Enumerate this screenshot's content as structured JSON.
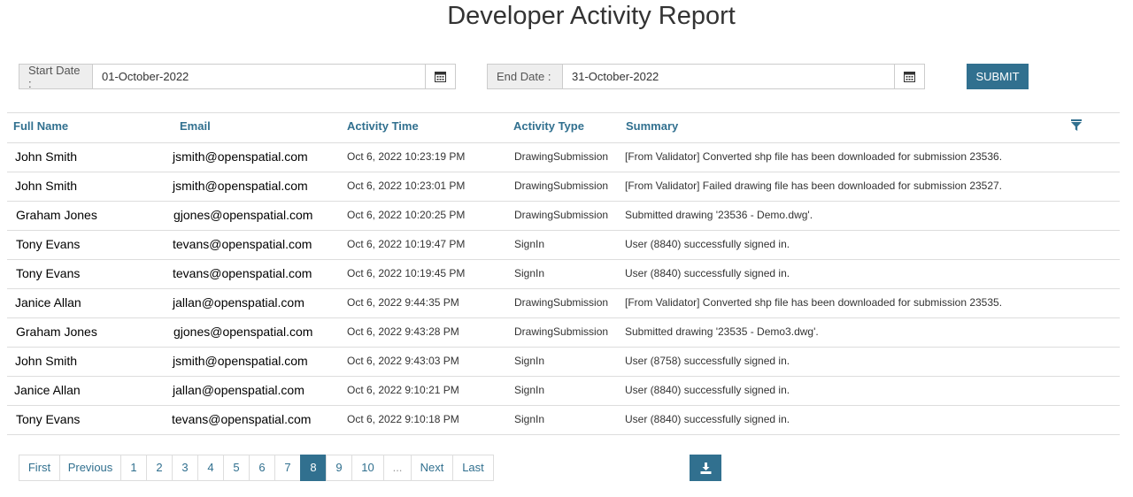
{
  "page": {
    "title": "Developer Activity Report"
  },
  "filters": {
    "start_label": "Start Date :",
    "start_value": "01-October-2022",
    "end_label": "End Date :",
    "end_value": "31-October-2022",
    "submit_label": "SUBMIT",
    "calendar_icon": "calendar-icon"
  },
  "table": {
    "headers": [
      "Full Name",
      "Email",
      "Activity Time",
      "Activity Type",
      "Summary"
    ],
    "filter_icon": "filter-icon",
    "rows": [
      [
        "John Smith",
        "jsmith@openspatial.com",
        "Oct 6, 2022 10:23:19 PM",
        "DrawingSubmission",
        "[From Validator] Converted shp file has been downloaded for submission 23536."
      ],
      [
        "John Smith",
        "jsmith@openspatial.com",
        "Oct 6, 2022 10:23:01 PM",
        "DrawingSubmission",
        "[From Validator] Failed drawing file has been downloaded for submission 23527."
      ],
      [
        "Graham Jones",
        "gjones@openspatial.com",
        "Oct 6, 2022 10:20:25 PM",
        "DrawingSubmission",
        "Submitted drawing '23536 - Demo.dwg'."
      ],
      [
        "Tony Evans",
        "tevans@openspatial.com",
        "Oct 6, 2022 10:19:47 PM",
        "SignIn",
        "User (8840) successfully signed in."
      ],
      [
        "Tony Evans",
        "tevans@openspatial.com",
        "Oct 6, 2022 10:19:45 PM",
        "SignIn",
        "User (8840) successfully signed in."
      ],
      [
        "Janice Allan",
        "jallan@openspatial.com",
        "Oct 6, 2022 9:44:35 PM",
        "DrawingSubmission",
        "[From Validator] Converted shp file has been downloaded for submission 23535."
      ],
      [
        "Graham Jones",
        "gjones@openspatial.com",
        "Oct 6, 2022 9:43:28 PM",
        "DrawingSubmission",
        "Submitted drawing '23535 - Demo3.dwg'."
      ],
      [
        "John Smith",
        "jsmith@openspatial.com",
        "Oct 6, 2022 9:43:03 PM",
        "SignIn",
        "User (8758) successfully signed in."
      ],
      [
        "Janice Allan",
        "jallan@openspatial.com",
        "Oct 6, 2022 9:10:21 PM",
        "SignIn",
        "User (8840) successfully signed in."
      ],
      [
        "Tony Evans",
        "tevans@openspatial.com",
        "Oct 6, 2022 9:10:18 PM",
        "SignIn",
        "User (8840) successfully signed in."
      ]
    ]
  },
  "pagination": {
    "items": [
      "First",
      "Previous",
      "1",
      "2",
      "3",
      "4",
      "5",
      "6",
      "7",
      "8",
      "9",
      "10",
      "...",
      "Next",
      "Last"
    ],
    "active": "8"
  },
  "download": {
    "icon": "download-icon"
  },
  "colors": {
    "accent": "#31708f",
    "header_text": "#31708f",
    "border": "#dddddd",
    "addon_bg": "#eeeeee"
  }
}
